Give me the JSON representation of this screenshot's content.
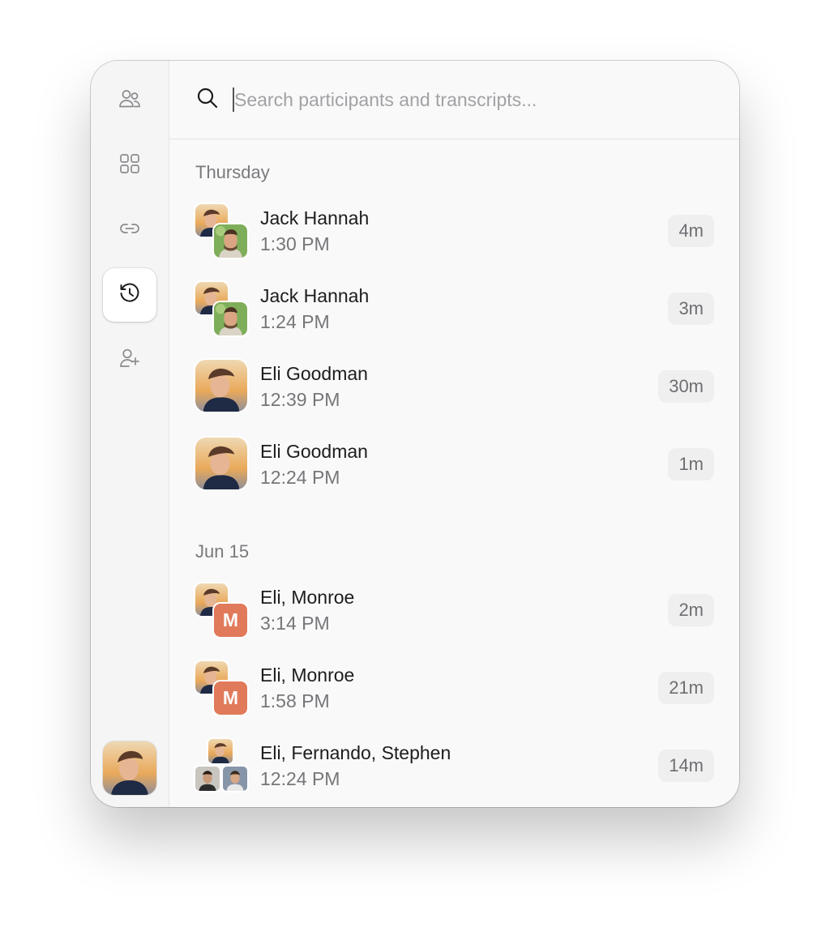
{
  "sidebar": {
    "items": [
      {
        "icon": "people-icon",
        "active": false
      },
      {
        "icon": "grid-icon",
        "active": false
      },
      {
        "icon": "link-icon",
        "active": false
      },
      {
        "icon": "history-icon",
        "active": true
      },
      {
        "icon": "add-person-icon",
        "active": false
      }
    ],
    "profile_icon": "profile-avatar"
  },
  "search": {
    "icon": "search-icon",
    "placeholder": "Search participants and transcripts..."
  },
  "groups": [
    {
      "label": "Thursday",
      "items": [
        {
          "name": "Jack Hannah",
          "time": "1:30 PM",
          "duration": "4m",
          "avatars": [
            "eli",
            "jack"
          ]
        },
        {
          "name": "Jack Hannah",
          "time": "1:24 PM",
          "duration": "3m",
          "avatars": [
            "eli",
            "jack"
          ]
        },
        {
          "name": "Eli Goodman",
          "time": "12:39 PM",
          "duration": "30m",
          "avatars": [
            "eli"
          ]
        },
        {
          "name": "Eli Goodman",
          "time": "12:24 PM",
          "duration": "1m",
          "avatars": [
            "eli"
          ]
        }
      ]
    },
    {
      "label": "Jun 15",
      "items": [
        {
          "name": "Eli, Monroe",
          "time": "3:14 PM",
          "duration": "2m",
          "avatars": [
            "eli",
            "M"
          ]
        },
        {
          "name": "Eli, Monroe",
          "time": "1:58 PM",
          "duration": "21m",
          "avatars": [
            "eli",
            "M"
          ]
        },
        {
          "name": "Eli, Fernando, Stephen",
          "time": "12:24 PM",
          "duration": "14m",
          "avatars": [
            "eli",
            "fernando",
            "stephen"
          ]
        }
      ]
    }
  ],
  "colors": {
    "monogram_bg": "#e07a5a",
    "badge_bg": "#efefef"
  }
}
